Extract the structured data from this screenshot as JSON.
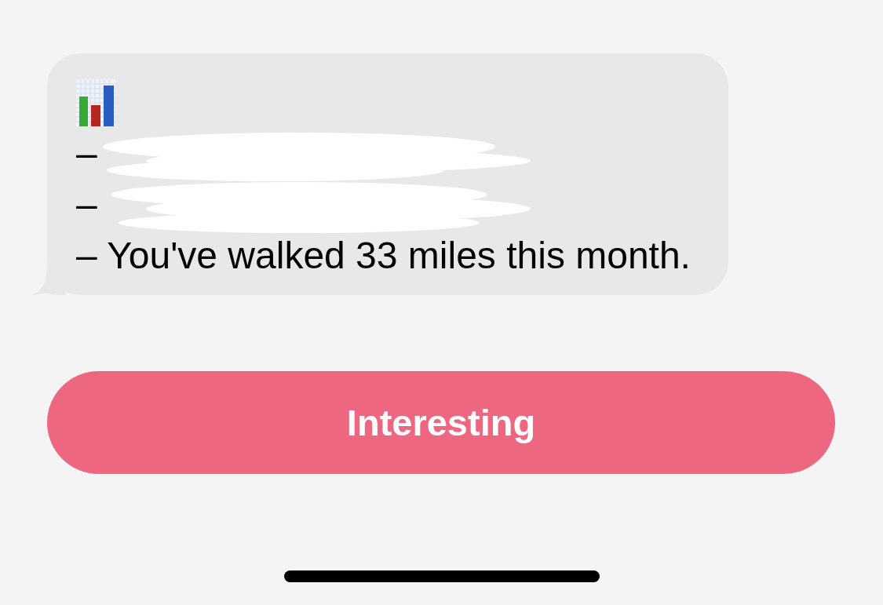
{
  "message": {
    "lines": [
      {
        "kind": "redacted",
        "text": "–"
      },
      {
        "kind": "redacted",
        "text": "–"
      },
      {
        "kind": "text",
        "text": "– You've walked 33 miles this month."
      }
    ]
  },
  "button": {
    "label": "Interesting"
  }
}
